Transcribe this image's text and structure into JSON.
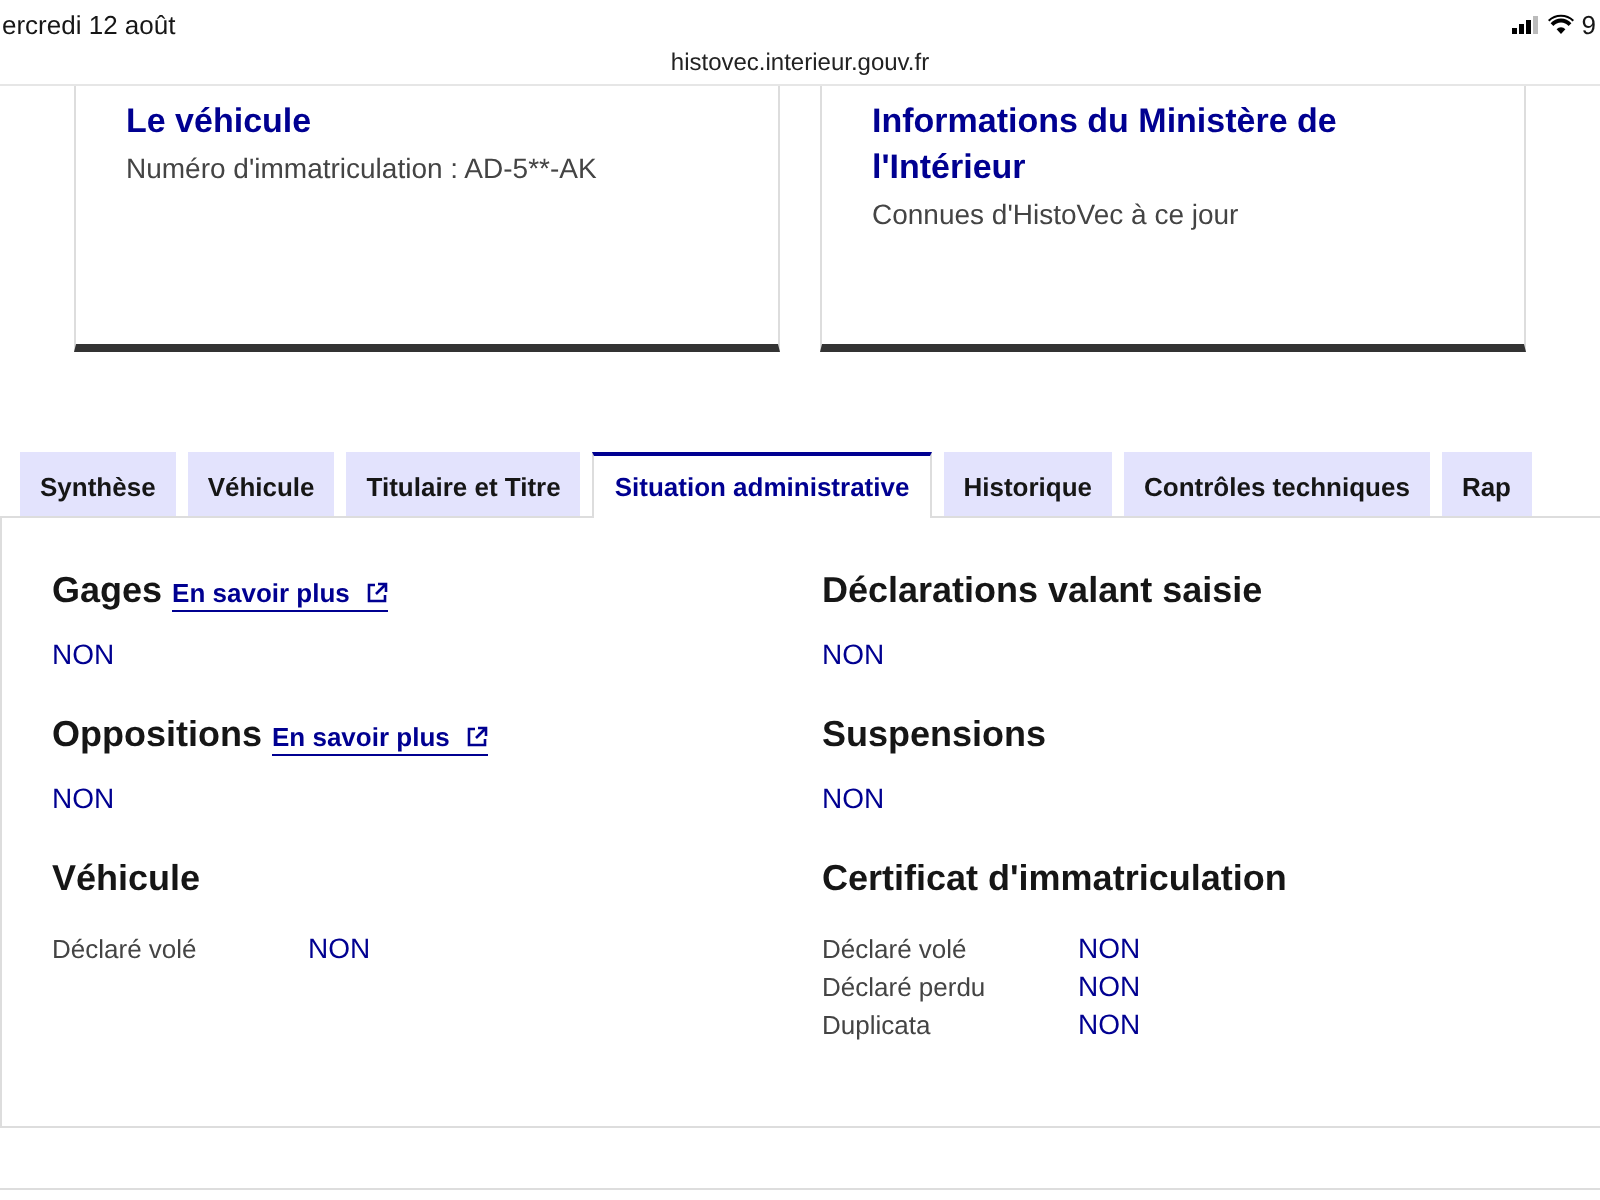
{
  "status_bar": {
    "date": "ercredi 12 août",
    "battery": "9"
  },
  "url": "histovec.interieur.gouv.fr",
  "cards": [
    {
      "title": "Le véhicule",
      "text": "Numéro d'immatriculation : AD-5**-AK"
    },
    {
      "title": "Informations du Ministère de l'Intérieur",
      "text": "Connues d'HistoVec à ce jour"
    }
  ],
  "tabs": [
    {
      "label": "Synthèse",
      "selected": false
    },
    {
      "label": "Véhicule",
      "selected": false
    },
    {
      "label": "Titulaire et Titre",
      "selected": false
    },
    {
      "label": "Situation administrative",
      "selected": true
    },
    {
      "label": "Historique",
      "selected": false
    },
    {
      "label": "Contrôles techniques",
      "selected": false
    },
    {
      "label": "Rap",
      "selected": false
    }
  ],
  "columns": [
    [
      {
        "kind": "value",
        "title": "Gages",
        "link": "En savoir plus",
        "value": "NON"
      },
      {
        "kind": "value",
        "title": "Oppositions",
        "link": "En savoir plus",
        "value": "NON"
      },
      {
        "kind": "rows",
        "title": "Véhicule",
        "rows": [
          {
            "label": "Déclaré volé",
            "value": "NON"
          }
        ]
      }
    ],
    [
      {
        "kind": "value",
        "title": "Déclarations valant saisie",
        "value": "NON"
      },
      {
        "kind": "value",
        "title": "Suspensions",
        "value": "NON"
      },
      {
        "kind": "rows",
        "title": "Certificat d'immatriculation",
        "rows": [
          {
            "label": "Déclaré volé",
            "value": "NON"
          },
          {
            "label": "Déclaré perdu",
            "value": "NON"
          },
          {
            "label": "Duplicata",
            "value": "NON"
          }
        ]
      }
    ]
  ]
}
